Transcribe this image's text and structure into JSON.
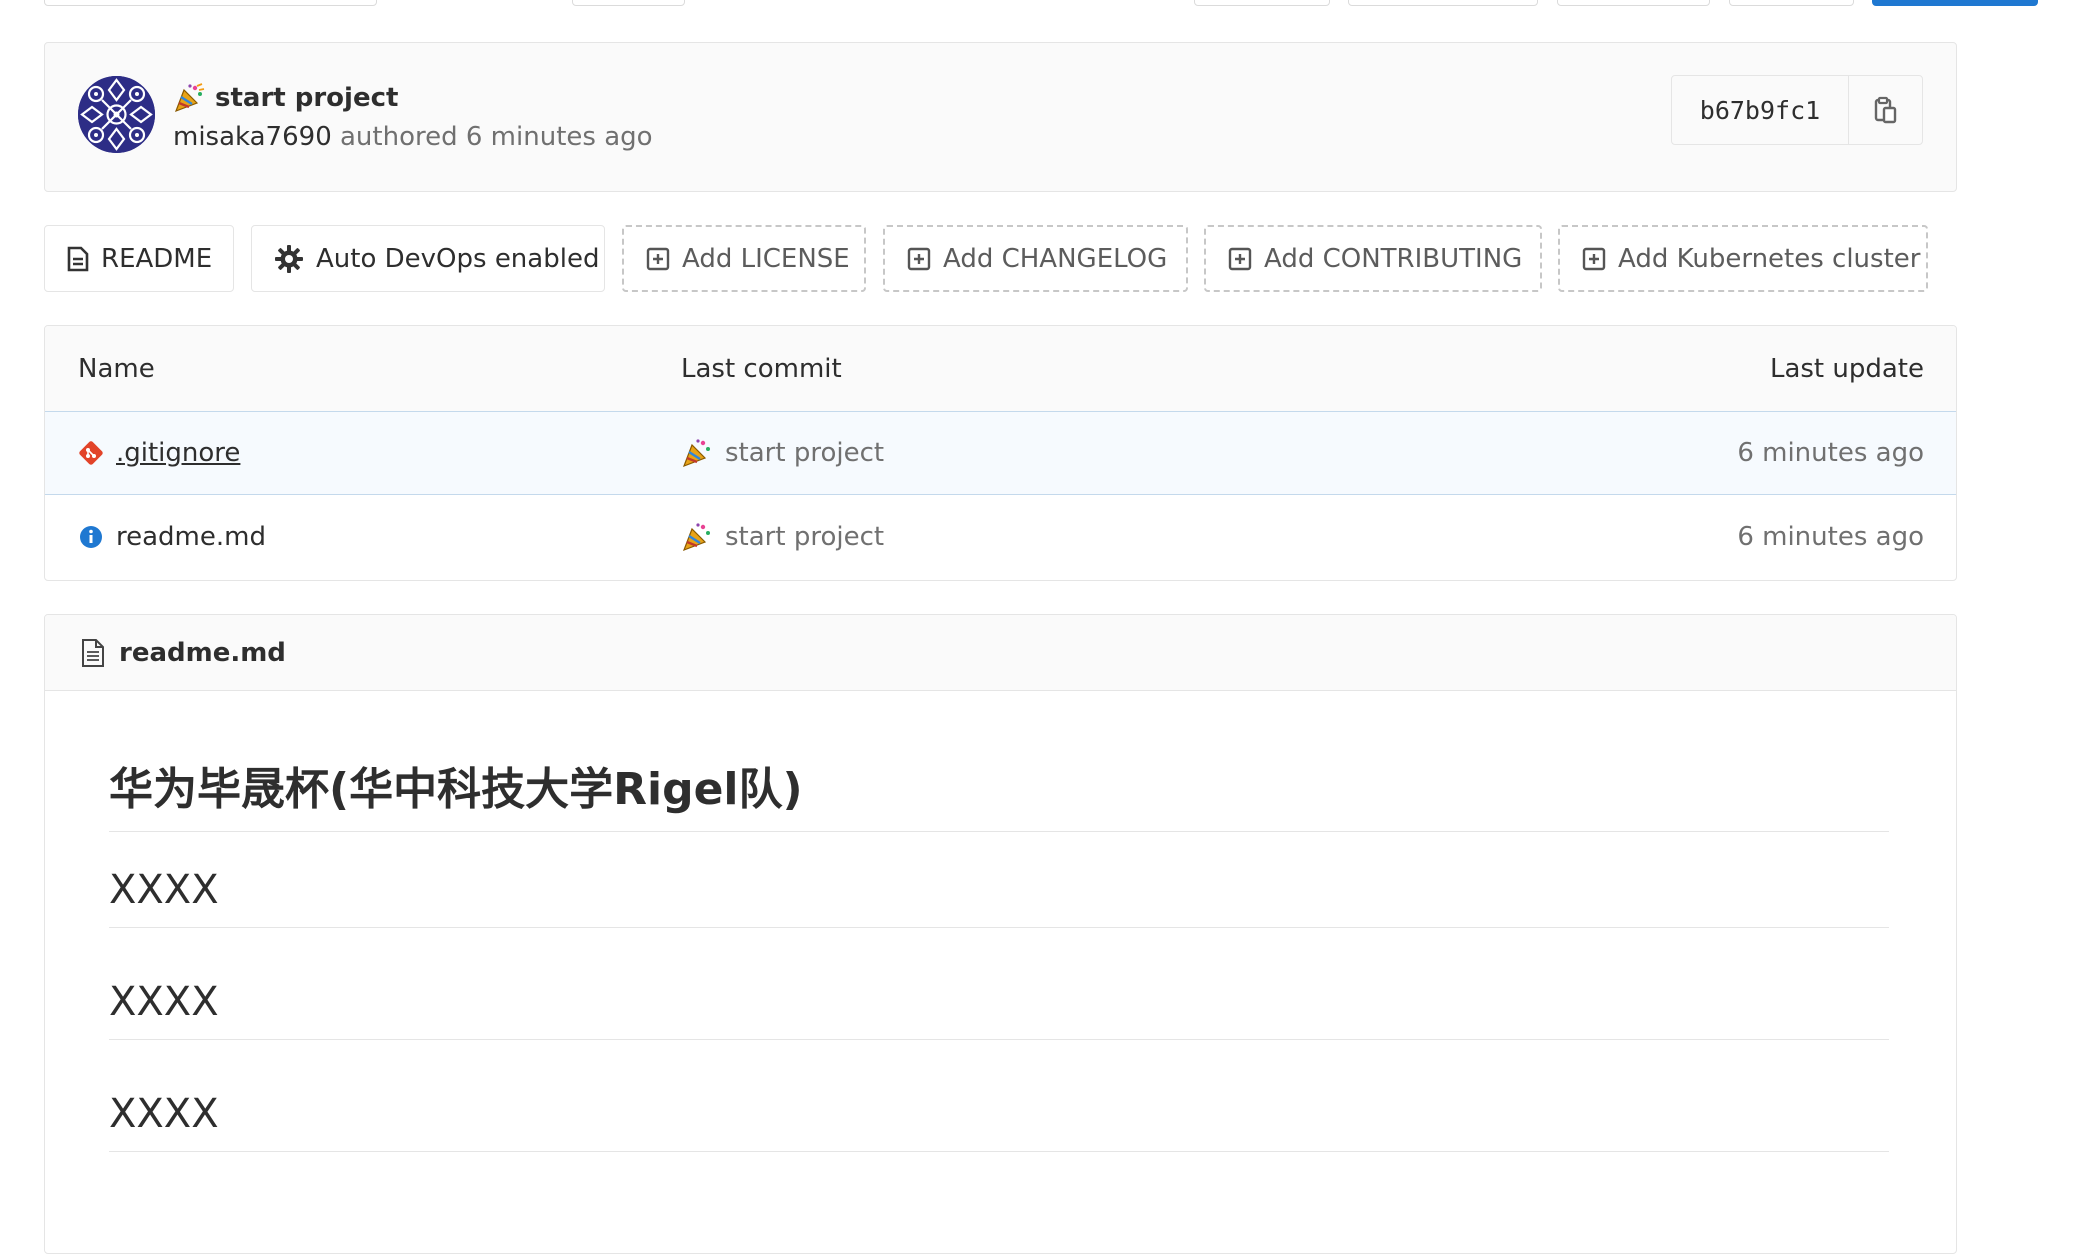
{
  "commit": {
    "title": "start project",
    "author": "misaka7690",
    "authored_label": "authored",
    "time": "6 minutes ago",
    "sha": "b67b9fc1"
  },
  "quick_links": [
    {
      "label": "README",
      "icon": "file-icon",
      "style": "solid"
    },
    {
      "label": "Auto DevOps enabled",
      "icon": "gear-icon",
      "style": "solid"
    },
    {
      "label": "Add LICENSE",
      "icon": "plus-square-icon",
      "style": "dashed"
    },
    {
      "label": "Add CHANGELOG",
      "icon": "plus-square-icon",
      "style": "dashed"
    },
    {
      "label": "Add CONTRIBUTING",
      "icon": "plus-square-icon",
      "style": "dashed"
    },
    {
      "label": "Add Kubernetes cluster",
      "icon": "plus-square-icon",
      "style": "dashed"
    }
  ],
  "tree": {
    "columns": [
      "Name",
      "Last commit",
      "Last update"
    ],
    "rows": [
      {
        "name": ".gitignore",
        "icon": "git-icon",
        "commit": "start project",
        "updated": "6 minutes ago"
      },
      {
        "name": "readme.md",
        "icon": "info-icon",
        "commit": "start project",
        "updated": "6 minutes ago"
      }
    ]
  },
  "readme": {
    "filename": "readme.md",
    "heading": "华为毕晟杯(华中科技大学Rigel队)",
    "sections": [
      "XXXX",
      "XXXX",
      "XXXX"
    ]
  },
  "colors": {
    "primary": "#1f78d1",
    "git_orange": "#e24329",
    "info_blue": "#1f78d1",
    "avatar_navy": "#2d2d86"
  }
}
